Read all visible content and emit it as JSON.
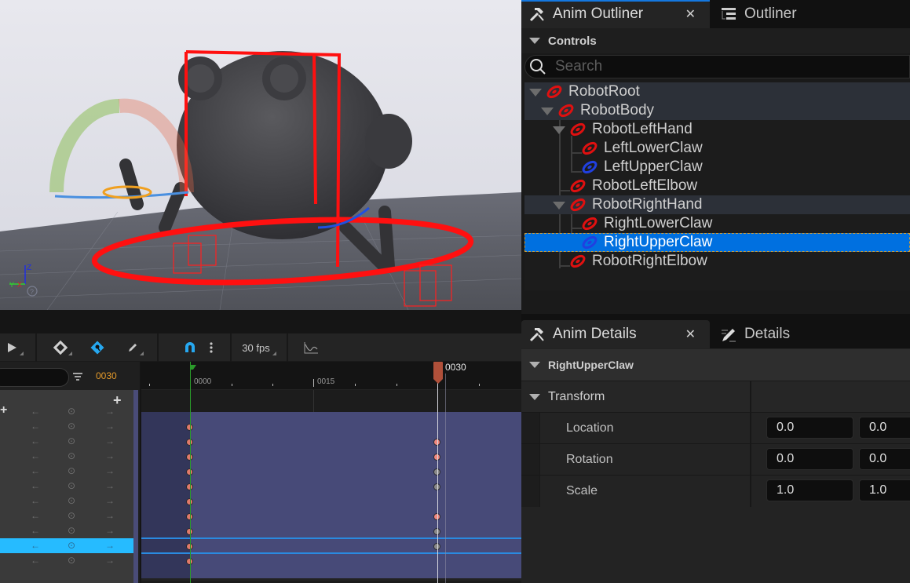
{
  "viewport": {
    "axis_labels": {
      "z": "Z",
      "y": "Y",
      "x": "X"
    },
    "help_icon": "question-circle-icon"
  },
  "sequencer": {
    "toolbar": {
      "play_icon": "play-icon",
      "key_icon": "keyframe-diamond-icon",
      "auto_key_icon": "auto-key-icon",
      "edit_icon": "pencil-icon",
      "snap_icon": "magnet-icon",
      "more_icon": "vertical-ellipsis-icon",
      "fps": "30 fps",
      "curve_icon": "curve-editor-icon"
    },
    "current_frame": "0030",
    "ruler": {
      "labels": [
        "0000",
        "0015"
      ],
      "playhead_label": "0030"
    },
    "tracks": [
      {
        "selected": false,
        "keys": []
      },
      {
        "selected": false,
        "keys": [
          {
            "frame": 0,
            "color": "#e07a6a"
          }
        ]
      },
      {
        "selected": false,
        "keys": [
          {
            "frame": 0,
            "color": "#e07a6a"
          },
          {
            "frame": 30,
            "color": "#f08880"
          }
        ]
      },
      {
        "selected": false,
        "keys": [
          {
            "frame": 0,
            "color": "#e07a6a"
          },
          {
            "frame": 30,
            "color": "#f08880"
          }
        ]
      },
      {
        "selected": false,
        "keys": [
          {
            "frame": 0,
            "color": "#e07a6a"
          },
          {
            "frame": 30,
            "color": "#8a8a8a"
          }
        ]
      },
      {
        "selected": false,
        "keys": [
          {
            "frame": 0,
            "color": "#e07a6a"
          },
          {
            "frame": 30,
            "color": "#8a8a8a"
          }
        ]
      },
      {
        "selected": false,
        "keys": [
          {
            "frame": 0,
            "color": "#e07a6a"
          }
        ]
      },
      {
        "selected": false,
        "keys": [
          {
            "frame": 0,
            "color": "#e07a6a"
          },
          {
            "frame": 30,
            "color": "#f08880"
          }
        ]
      },
      {
        "selected": false,
        "keys": [
          {
            "frame": 0,
            "color": "#e07a6a"
          },
          {
            "frame": 30,
            "color": "#8a8a8a"
          }
        ]
      },
      {
        "selected": true,
        "keys": [
          {
            "frame": 0,
            "color": "#e07a6a"
          },
          {
            "frame": 30,
            "color": "#8a8a8a"
          }
        ]
      },
      {
        "selected": false,
        "keys": [
          {
            "frame": 0,
            "color": "#e07a6a"
          }
        ]
      }
    ]
  },
  "outliner": {
    "tabs": [
      {
        "label": "Anim Outliner",
        "icon": "anim-tools-icon",
        "active": true,
        "closable": true
      },
      {
        "label": "Outliner",
        "icon": "outliner-list-icon",
        "active": false
      }
    ],
    "section": "Controls",
    "search_placeholder": "Search",
    "items": [
      {
        "label": "RobotRoot",
        "depth": 0,
        "color": "#e01010",
        "expanded": true,
        "highlighted": true
      },
      {
        "label": "RobotBody",
        "depth": 1,
        "color": "#e01010",
        "expanded": true,
        "highlighted": true
      },
      {
        "label": "RobotLeftHand",
        "depth": 2,
        "color": "#e01010",
        "expanded": true
      },
      {
        "label": "LeftLowerClaw",
        "depth": 3,
        "color": "#e01010"
      },
      {
        "label": "LeftUpperClaw",
        "depth": 3,
        "color": "#2040e0"
      },
      {
        "label": "RobotLeftElbow",
        "depth": 2,
        "color": "#e01010"
      },
      {
        "label": "RobotRightHand",
        "depth": 2,
        "color": "#e01010",
        "expanded": true,
        "highlighted": true
      },
      {
        "label": "RightLowerClaw",
        "depth": 3,
        "color": "#e01010"
      },
      {
        "label": "RightUpperClaw",
        "depth": 3,
        "color": "#2040e0",
        "selected": true
      },
      {
        "label": "RobotRightElbow",
        "depth": 2,
        "color": "#e01010"
      }
    ]
  },
  "details": {
    "tabs": [
      {
        "label": "Anim Details",
        "icon": "anim-tools-icon",
        "active": true,
        "closable": true
      },
      {
        "label": "Details",
        "icon": "details-pencil-icon",
        "active": false
      }
    ],
    "object_name": "RightUpperClaw",
    "section": "Transform",
    "properties": [
      {
        "label": "Location",
        "values": [
          "0.0",
          "0.0"
        ]
      },
      {
        "label": "Rotation",
        "values": [
          "0.0",
          "0.0"
        ]
      },
      {
        "label": "Scale",
        "values": [
          "1.0",
          "1.0"
        ]
      }
    ]
  },
  "colors": {
    "accent_blue": "#0070e0",
    "selected_track": "#26bbff",
    "frame_counter": "#e59a2a",
    "playhead": "#b0503a"
  }
}
